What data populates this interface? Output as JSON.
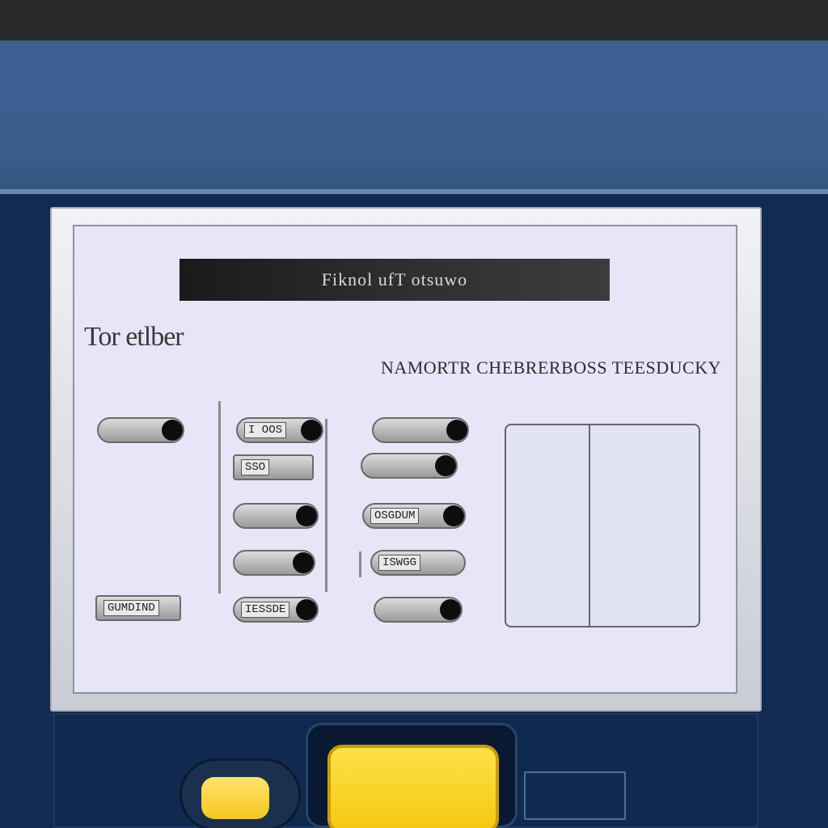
{
  "panel": {
    "title": "Fiknol ufT  otsuwo",
    "heading": "Tor etlber",
    "subheading": "NAMORTR CHEBRERBOSS TEESDUCKY"
  },
  "toggles": [
    {
      "id": "t1",
      "label": ""
    },
    {
      "id": "t2",
      "label": "I OOS"
    },
    {
      "id": "t3",
      "label": ""
    },
    {
      "id": "t4",
      "label": "SSO"
    },
    {
      "id": "t5",
      "label": ""
    },
    {
      "id": "t6",
      "label": ""
    },
    {
      "id": "t7",
      "label": "OSGDUM"
    },
    {
      "id": "t8",
      "label": ""
    },
    {
      "id": "t9",
      "label": "ISWGG"
    },
    {
      "id": "t10",
      "label": "GUMDIND"
    },
    {
      "id": "t11",
      "label": "IESSDE"
    },
    {
      "id": "t12",
      "label": ""
    }
  ],
  "colors": {
    "accent_yellow": "#f5c71f",
    "panel_bg": "#e6e6f8",
    "header_blue": "#3b5d8e",
    "body_navy": "#112b52"
  }
}
